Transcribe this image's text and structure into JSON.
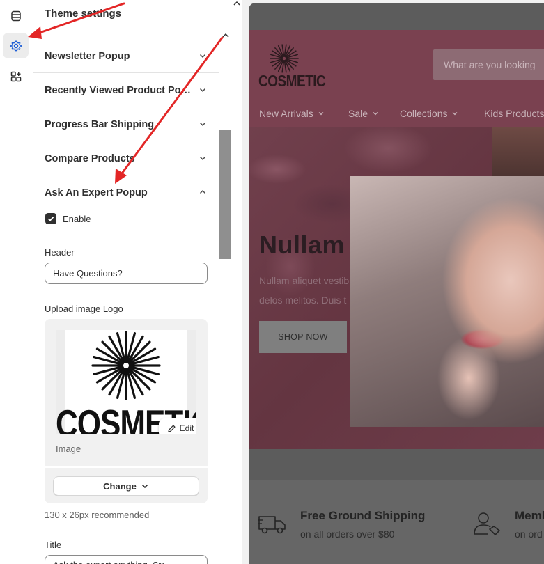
{
  "panel": {
    "title": "Theme settings",
    "sections": [
      {
        "label": "Newsletter Popup"
      },
      {
        "label": "Recently Viewed Product Pop…"
      },
      {
        "label": "Progress Bar Shipping"
      },
      {
        "label": "Compare Products"
      }
    ],
    "expanded_section": {
      "label": "Ask An Expert Popup",
      "enable_label": "Enable",
      "enabled": true,
      "header_label": "Header",
      "header_value": "Have Questions?",
      "upload_label": "Upload image Logo",
      "logo_text": "COSMETIC",
      "edit_label": "Edit",
      "image_caption": "Image",
      "change_label": "Change",
      "hint": "130 x 26px recommended",
      "title_label": "Title",
      "title_value": "Ask the expert anything. Str"
    }
  },
  "preview": {
    "brand": "COSMETIC",
    "search_placeholder": "What are you looking",
    "nav": [
      {
        "label": "New Arrivals"
      },
      {
        "label": "Sale"
      },
      {
        "label": "Collections"
      },
      {
        "label": "Kids Products"
      }
    ],
    "hero": {
      "title": "Nullam",
      "text_line1": "Nullam aliquet vestib",
      "text_line2": "delos melitos. Duis t",
      "button": "SHOP NOW"
    },
    "features": [
      {
        "title": "Free Ground Shipping",
        "subtitle": "on all orders over $80"
      },
      {
        "title": "Memb",
        "subtitle": "on ord"
      }
    ]
  },
  "colors": {
    "header_bg": "#7a4150",
    "annotation_arrow": "#e32626",
    "checkbox": "#303030"
  },
  "icons": [
    "sections-icon",
    "gear-icon",
    "apps-icon",
    "chevron-down-icon",
    "chevron-up-icon",
    "pencil-icon",
    "truck-icon",
    "member-icon",
    "starburst-logo-icon"
  ]
}
